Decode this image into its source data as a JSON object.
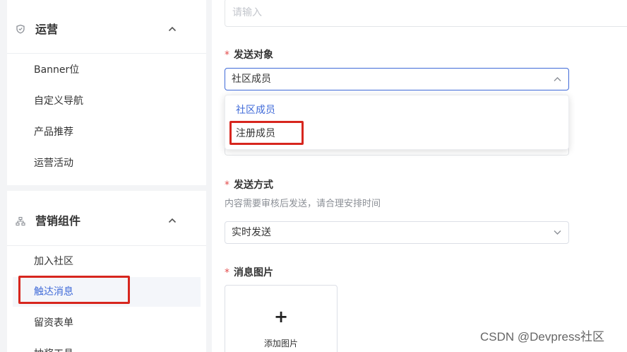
{
  "sidebar": {
    "operations": {
      "title": "运营",
      "icon": "shield-icon",
      "items": [
        "Banner位",
        "自定义导航",
        "产品推荐",
        "运营活动"
      ]
    },
    "marketing": {
      "title": "营销组件",
      "icon": "org-chart-icon",
      "items": [
        "加入社区",
        "触达消息",
        "留资表单",
        "抽奖工具"
      ],
      "active_item": "触达消息"
    }
  },
  "form": {
    "top_input": {
      "placeholder": "请输入",
      "value": ""
    },
    "target": {
      "required_mark": "*",
      "label": "发送对象",
      "value": "社区成员",
      "options": [
        "社区成员",
        "注册成员"
      ],
      "selected_option": "社区成员"
    },
    "send_method": {
      "required_mark": "*",
      "label": "发送方式",
      "hint": "内容需要审核后发送，请合理安排时间",
      "value": "实时发送"
    },
    "image": {
      "required_mark": "*",
      "label": "消息图片",
      "upload_symbol": "+",
      "upload_label": "添加图片"
    }
  },
  "watermark": "CSDN @Devpress社区",
  "colors": {
    "accent": "#3f6ad8",
    "highlight_box": "#d7261e",
    "required": "#e34d4d"
  }
}
